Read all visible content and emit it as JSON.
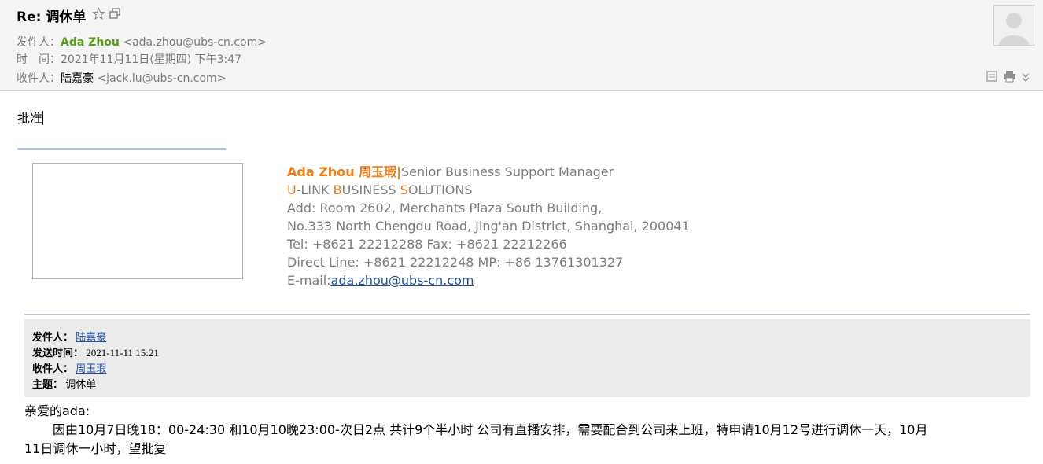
{
  "header": {
    "subject": "Re: 调休单",
    "from_label": "发件人：",
    "from_name": "Ada Zhou",
    "from_email": "<ada.zhou@ubs-cn.com>",
    "time_label": "时　间：",
    "time_value": "2021年11月11日(星期四) 下午3:47",
    "to_label": "收件人：",
    "to_name": "陆嘉豪",
    "to_email": "<jack.lu@ubs-cn.com>"
  },
  "reply_text": "批准",
  "signature": {
    "name": "Ada Zhou 周玉瑕",
    "separator": "|",
    "title": "Senior Business Support Manager",
    "company_u": "U",
    "company_1": "-LINK ",
    "company_b": "B",
    "company_2": "USINESS ",
    "company_s": "S",
    "company_3": "OLUTIONS",
    "addr1": "Add: Room 2602, Merchants Plaza South Building,",
    "addr2": "No.333 North Chengdu Road, Jing'an District, Shanghai, 200041",
    "tel": "Tel: +8621 22212288  Fax: +8621 22212266",
    "direct": "Direct Line: +8621 22212248   MP: +86 13761301327",
    "email_label": "E-mail:",
    "email": "ada.zhou@ubs-cn.com"
  },
  "quoted": {
    "from_label": "发件人：",
    "from_value": "陆嘉豪",
    "sent_label": "发送时间：",
    "sent_value": "2021-11-11 15:21",
    "to_label": "收件人：",
    "to_value": "周玉瑕",
    "subject_label": "主题：",
    "subject_value": "调休单"
  },
  "original": {
    "greeting": "亲爱的ada:",
    "line1": "因由10月7日晚18：00-24:30 和10月10晚23:00-次日2点 共计9个半小时 公司有直播安排，需要配合到公司来上班，特申请10月12号进行调休一天，10月",
    "line2": "11日调休一小时，望批复"
  }
}
